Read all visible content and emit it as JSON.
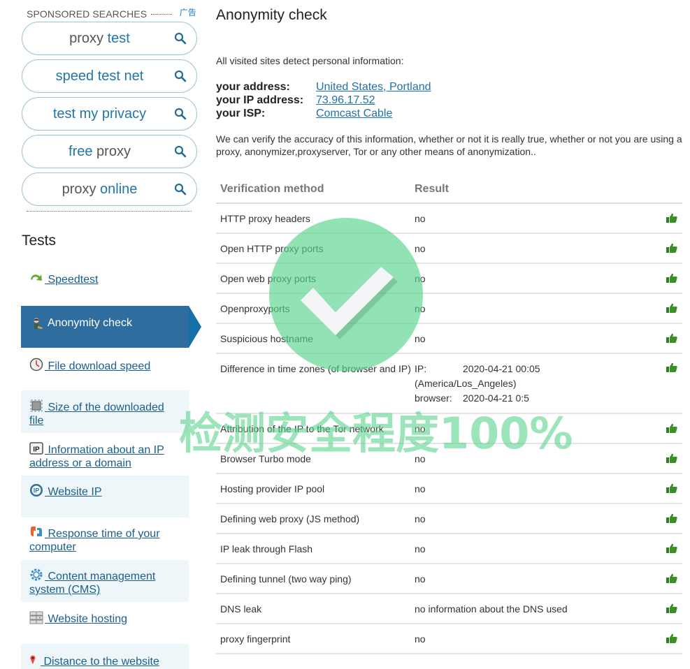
{
  "sidebar": {
    "sponsored_label": "SPONSORED SEARCHES",
    "ad_label": "广告",
    "sponsored_searches": [
      {
        "dark": "proxy",
        "blue": " test",
        "order": "dark-first"
      },
      {
        "dark": "",
        "blue": "speed test net",
        "order": "blue-only"
      },
      {
        "dark": "",
        "blue": "test my privacy",
        "order": "blue-only"
      },
      {
        "dark": " proxy",
        "blue": "free",
        "order": "blue-first"
      },
      {
        "dark": "proxy",
        "blue": " online",
        "order": "dark-first"
      }
    ],
    "tests_title": "Tests",
    "nav": [
      {
        "label": " Speedtest",
        "icon": "speedtest-arrow-icon",
        "active": false
      },
      {
        "label": "Anonymity check",
        "icon": "anonymity-person-icon",
        "active": true
      },
      {
        "label": " File download speed",
        "icon": "clock-icon",
        "active": false
      },
      {
        "label": " Size of the downloaded file",
        "icon": "file-size-icon",
        "active": false
      },
      {
        "label": " Information about an IP address or a domain",
        "icon": "ip-box-icon",
        "active": false
      },
      {
        "label": " Website IP",
        "icon": "ip-globe-icon",
        "active": false
      },
      {
        "label": " Response time of your computer",
        "icon": "response-time-icon",
        "active": false
      },
      {
        "label": " Content management system (CMS)",
        "icon": "cms-gear-icon",
        "active": false
      },
      {
        "label": " Website hosting",
        "icon": "hosting-server-icon",
        "active": false
      },
      {
        "label": " Distance to the website",
        "icon": "map-pin-icon",
        "active": false
      }
    ]
  },
  "main": {
    "title": "Anonymity check",
    "intro": "All visited sites detect personal information:",
    "info": [
      {
        "key": "your address:",
        "value": "United States, Portland"
      },
      {
        "key": "your IP address:",
        "value": "73.96.17.52"
      },
      {
        "key": "your ISP:",
        "value": "Comcast Cable"
      }
    ],
    "verify_text": "We can verify the accuracy of this information, whether or not it is really true, whether or not you are using a proxy, anonymizer,proxyserver, Tor or any other means of anonymization..",
    "table": {
      "headers": [
        "Verification method",
        "Result"
      ],
      "rows": [
        {
          "method": "HTTP proxy headers",
          "result": "no",
          "status": "thumbs-up"
        },
        {
          "method": "Open HTTP proxy ports",
          "result": "no",
          "status": "thumbs-up"
        },
        {
          "method": "Open web proxy ports",
          "result": "no",
          "status": "thumbs-up"
        },
        {
          "method": "Openproxyports",
          "result": "no",
          "status": "thumbs-up"
        },
        {
          "method": "Suspicious hostname",
          "result": "no",
          "status": "thumbs-up"
        },
        {
          "method": "Difference in time zones (of browser and IP)",
          "result": "",
          "status": "thumbs-up",
          "tz": {
            "ip_label": "IP:",
            "ip_value": "2020-04-21 00:05",
            "ip_zone": "(America/Los_Angeles)",
            "browser_label": "browser:",
            "browser_value": "2020-04-21 0:5"
          }
        },
        {
          "method": "Attribution of the IP to the Tor network",
          "result": "no",
          "status": "thumbs-up"
        },
        {
          "method": "Browser Turbo mode",
          "result": "no",
          "status": "thumbs-up"
        },
        {
          "method": "Hosting provider IP pool",
          "result": "no",
          "status": "thumbs-up"
        },
        {
          "method": "Defining web proxy (JS method)",
          "result": "no",
          "status": "thumbs-up"
        },
        {
          "method": "IP leak through Flash",
          "result": "no",
          "status": "thumbs-up"
        },
        {
          "method": "Defining tunnel (two way ping)",
          "result": "no",
          "status": "thumbs-up"
        },
        {
          "method": "DNS leak",
          "result": "no information about the DNS used",
          "status": "thumbs-up"
        },
        {
          "method": "proxy fingerprint",
          "result": "no",
          "status": "thumbs-up"
        }
      ]
    }
  },
  "overlay": {
    "text": "检测安全程度100%",
    "color": "#58d48c"
  }
}
